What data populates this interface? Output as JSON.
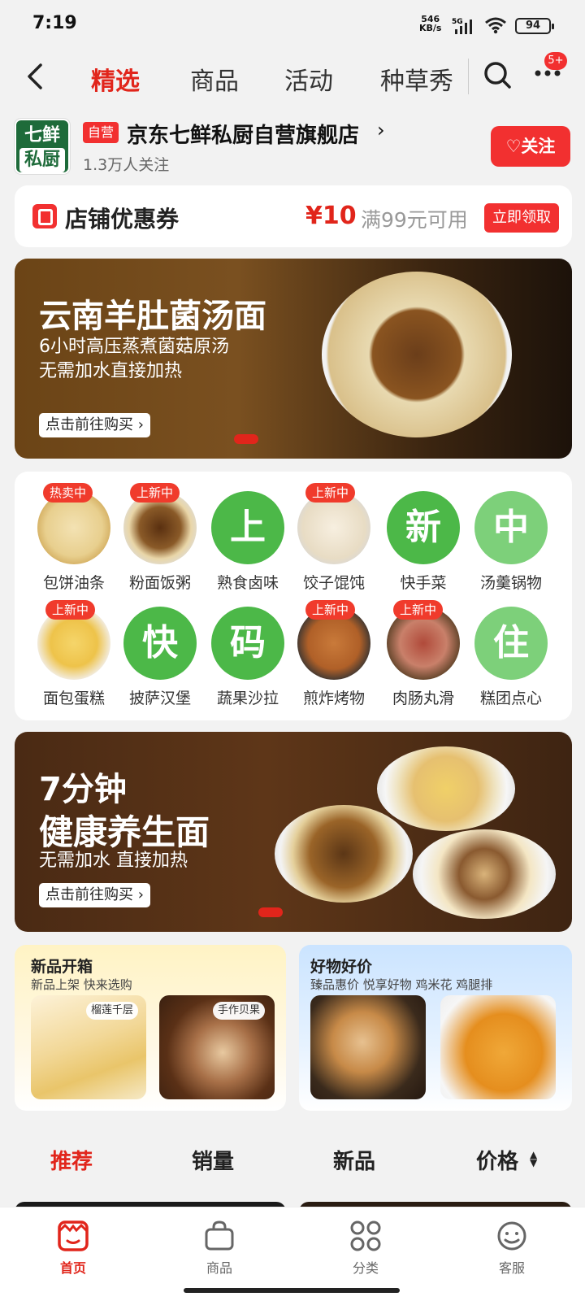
{
  "status_bar": {
    "time": "7:19",
    "net_speed_value": "546",
    "net_speed_unit": "KB/s",
    "network": "5G",
    "battery": "94"
  },
  "nav": {
    "tabs": [
      {
        "label": "精选",
        "active": true
      },
      {
        "label": "商品",
        "active": false
      },
      {
        "label": "活动",
        "active": false
      },
      {
        "label": "种草秀",
        "active": false
      }
    ],
    "badge": "5+"
  },
  "store": {
    "logo_line1": "七鲜",
    "logo_line2": "私厨",
    "self_tag": "自营",
    "name": "京东七鲜私厨自营旗舰店",
    "arrow": "›",
    "followers": "1.3万人关注",
    "follow_label": "关注",
    "heart": "♡"
  },
  "coupon": {
    "title": "店铺优惠券",
    "amount": "¥10",
    "condition": "满99元可用",
    "button": "立即领取"
  },
  "banner1": {
    "title": "云南羊肚菌汤面",
    "sub1": "6小时高压蒸煮菌菇原汤",
    "sub2": "无需加水直接加热",
    "button": "点击前往购买 ›"
  },
  "categories": [
    {
      "label": "包饼油条",
      "tag": "热卖中",
      "icon": "bun-image"
    },
    {
      "label": "粉面饭粥",
      "tag": "上新中",
      "icon": "noodle-image"
    },
    {
      "label": "熟食卤味",
      "tag": "",
      "glyph": "上"
    },
    {
      "label": "饺子馄饨",
      "tag": "上新中",
      "icon": "dumpling-image"
    },
    {
      "label": "快手菜",
      "tag": "",
      "glyph": "新"
    },
    {
      "label": "汤羹锅物",
      "tag": "",
      "glyph": "中"
    },
    {
      "label": "面包蛋糕",
      "tag": "上新中",
      "icon": "cake-image"
    },
    {
      "label": "披萨汉堡",
      "tag": "",
      "glyph": "快"
    },
    {
      "label": "蔬果沙拉",
      "tag": "",
      "glyph": "码"
    },
    {
      "label": "煎炸烤物",
      "tag": "上新中",
      "icon": "fried-image"
    },
    {
      "label": "肉肠丸滑",
      "tag": "上新中",
      "icon": "sausage-image"
    },
    {
      "label": "糕团点心",
      "tag": "",
      "glyph": "住"
    }
  ],
  "banner2": {
    "title1": "7分钟",
    "title2": "健康养生面",
    "sub": "无需加水 直接加热",
    "button": "点击前往购买 ›"
  },
  "promo_left": {
    "title": "新品开箱",
    "sub": "新品上架 快来选购",
    "tag1": "榴莲千层",
    "tag2": "手作贝果"
  },
  "promo_right": {
    "title": "好物好价",
    "sub": "臻品惠价 悦享好物 鸡米花 鸡腿排"
  },
  "sort": [
    {
      "label": "推荐",
      "active": true
    },
    {
      "label": "销量",
      "active": false
    },
    {
      "label": "新品",
      "active": false
    },
    {
      "label": "价格",
      "active": false
    }
  ],
  "bottom_nav": [
    {
      "label": "首页",
      "active": true
    },
    {
      "label": "商品",
      "active": false
    },
    {
      "label": "分类",
      "active": false
    },
    {
      "label": "客服",
      "active": false
    }
  ],
  "colors": {
    "accent": "#e1251b",
    "badge_red": "#f23030",
    "category_green": "#4cb848"
  }
}
